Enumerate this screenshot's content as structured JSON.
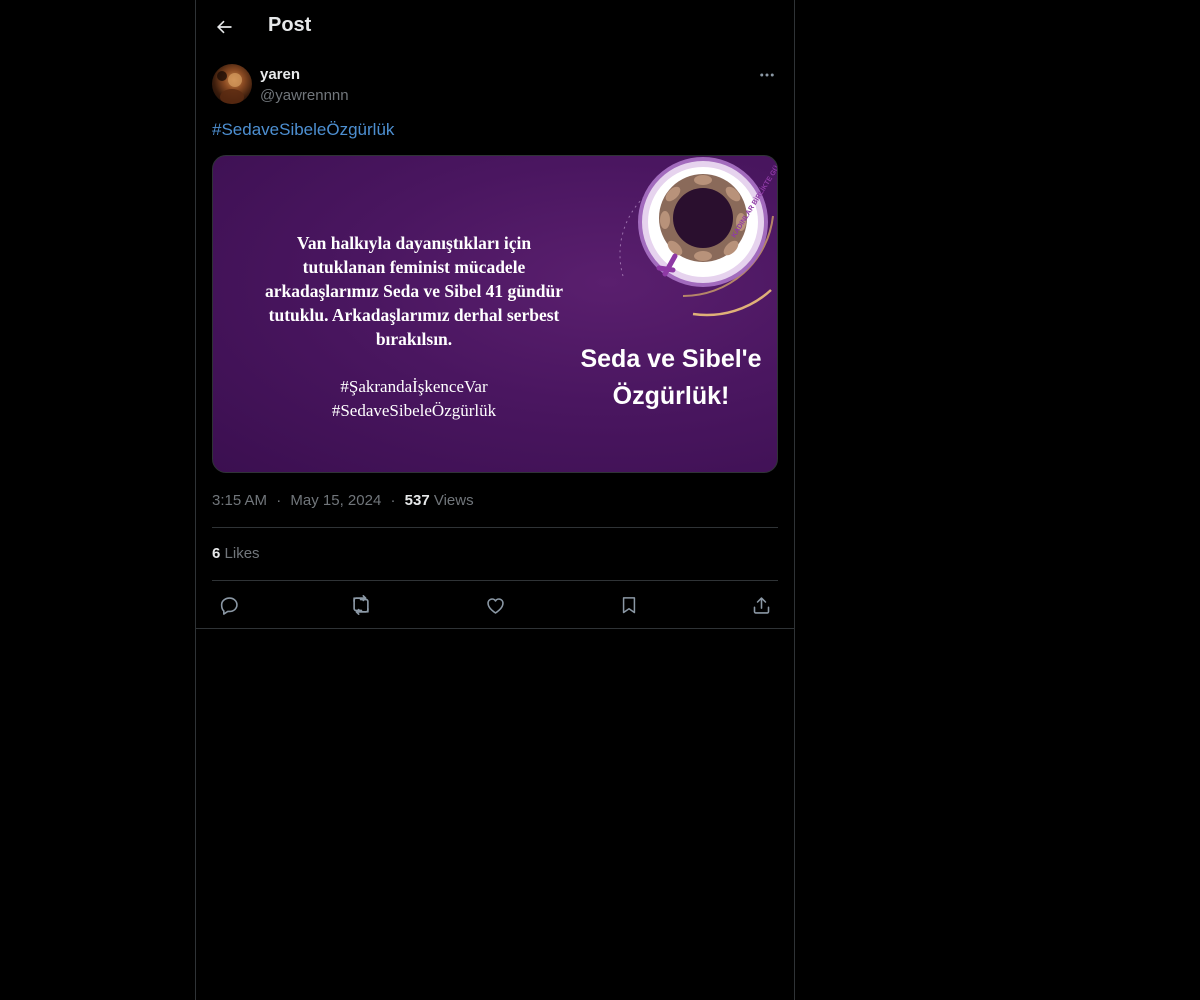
{
  "header": {
    "back_icon": "arrow-left-icon",
    "title": "Post"
  },
  "author": {
    "display_name": "yaren",
    "handle": "@yawrennnn",
    "more_icon": "more-horizontal-icon"
  },
  "post": {
    "text": "#SedaveSibeleÖzgürlük",
    "hashtag_color": "#4d8fd1"
  },
  "media": {
    "body_lines": [
      "Van halkıyla dayanıştıkları için",
      "tutuklanan feminist mücadele",
      "arkadaşlarımız Seda ve Sibel 41 gündür",
      "tutuklu. Arkadaşlarımız derhal serbest",
      "bırakılsın."
    ],
    "hashtags": [
      "#ŞakrandaİşkenceVar",
      "#SedaveSibeleÖzgürlük"
    ],
    "headline_lines": [
      "Seda ve Sibel'e",
      "Özgürlük!"
    ],
    "logo_text": "KADINLAR BİRLİKTE GÜÇLÜ",
    "background_color": "#4a1660"
  },
  "meta": {
    "time": "3:15 AM",
    "separator": "·",
    "date": "May 15, 2024",
    "views_count": "537",
    "views_label": "Views"
  },
  "stats": {
    "likes_count": "6",
    "likes_label": "Likes"
  },
  "actions": [
    {
      "icon": "reply-icon"
    },
    {
      "icon": "repost-icon"
    },
    {
      "icon": "like-icon"
    },
    {
      "icon": "bookmark-icon"
    },
    {
      "icon": "share-icon"
    }
  ]
}
